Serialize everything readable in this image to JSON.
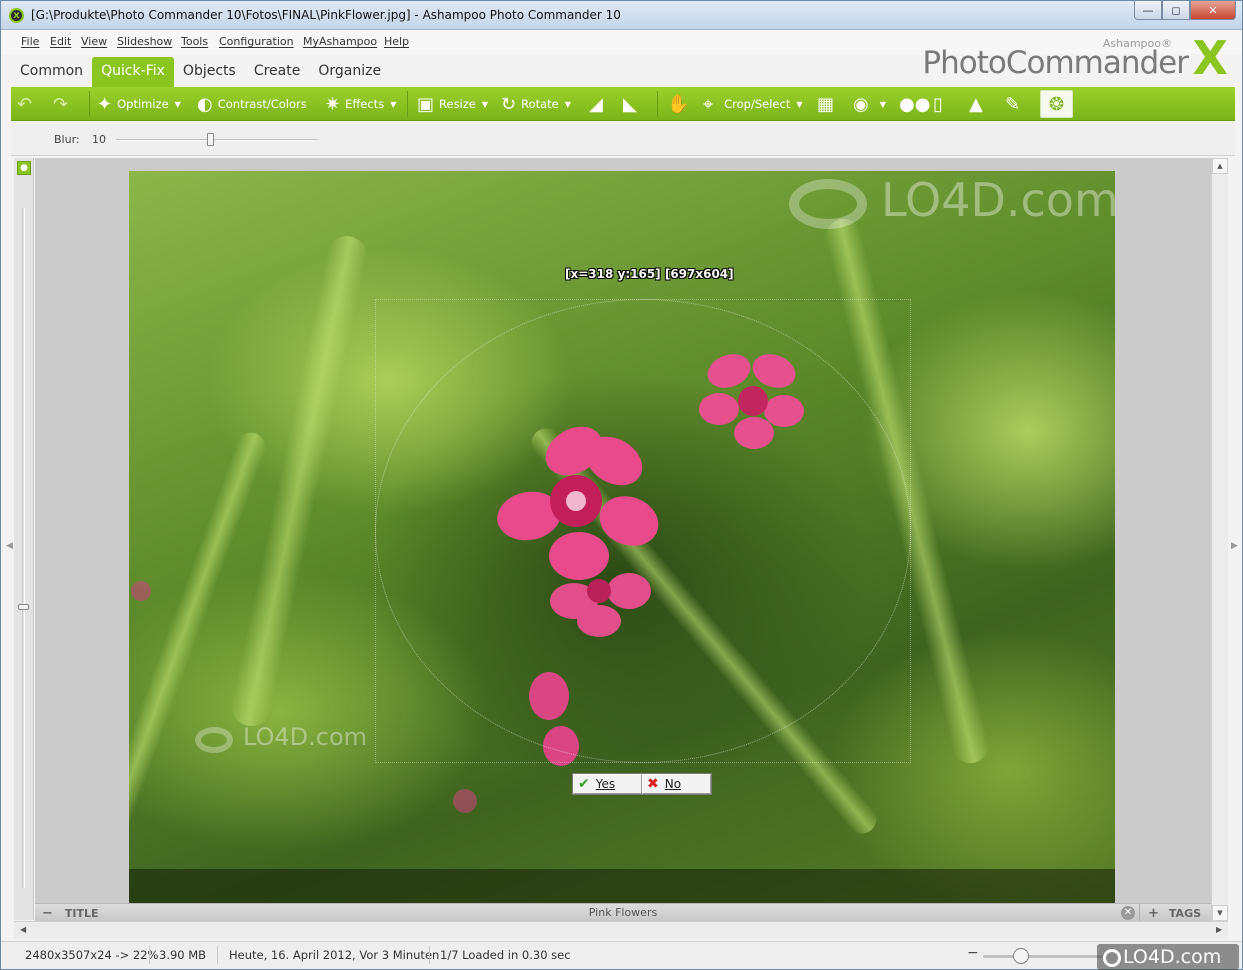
{
  "window": {
    "title": "[G:\\Produkte\\Photo Commander 10\\Fotos\\FINAL\\PinkFlower.jpg] - Ashampoo Photo Commander 10"
  },
  "menu": [
    "File",
    "Edit",
    "View",
    "Slideshow",
    "Tools",
    "Configuration",
    "MyAshampoo",
    "Help"
  ],
  "brand": {
    "small": "Ashampoo®",
    "main": "PhotoCommander",
    "x": "X"
  },
  "tabs": [
    "Common",
    "Quick-Fix",
    "Objects",
    "Create",
    "Organize"
  ],
  "active_tab": "Quick-Fix",
  "toolbar": {
    "optimize": "Optimize",
    "contrast": "Contrast/Colors",
    "effects": "Effects",
    "resize": "Resize",
    "rotate": "Rotate",
    "crop": "Crop/Select"
  },
  "options": {
    "blur_label": "Blur:",
    "blur_value": "10",
    "blur_fraction": 0.47
  },
  "selection": {
    "readout": "[x=318 y:165] [697x604]",
    "yes": "Yes",
    "no": "No"
  },
  "watermark": {
    "text": "LO4D.com"
  },
  "caption_bar": {
    "left": "TITLE",
    "center": "Pink Flowers",
    "right": "TAGS"
  },
  "status": {
    "dims": "2480x3507x24 -> 22%",
    "size": "3.90 MB",
    "date": "Heute, 16. April 2012, Vor 3 Minuten",
    "loaded": "1/7  Loaded in 0.30 sec"
  },
  "badge": {
    "text": "LO4D.com"
  },
  "colors": {
    "accent": "#8bc51f",
    "toolbar": "#84bd1e"
  }
}
